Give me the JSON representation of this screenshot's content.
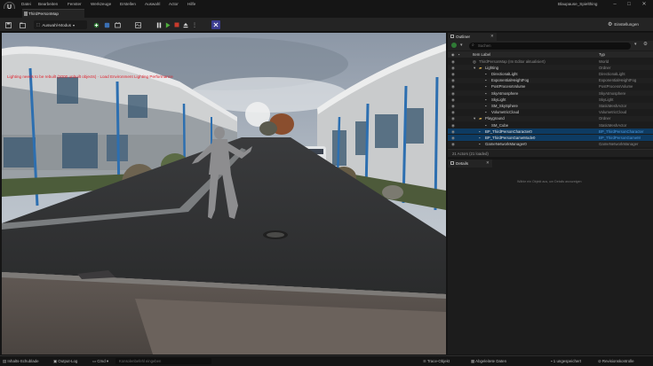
{
  "menu": [
    "Datei",
    "Bearbeiten",
    "Fenster",
    "Werkzeuge",
    "Erstellen",
    "Auswahl",
    "Actor",
    "Hilfe"
  ],
  "project_name": "Blaupause_Spielthing",
  "map_tab": "ThirdPersonMap",
  "toolbar": {
    "mode_label": "Auswahl-Modus",
    "settings_label": "Einstellungen"
  },
  "viewport": {
    "overlay_text": "Lighting needs to be rebuilt (2000 unbuilt objects) · Load Environment Lighting Performance"
  },
  "outliner": {
    "tab_label": "Outliner",
    "search_placeholder": "Suchen",
    "col_label": "Item Label",
    "col_type": "Typ",
    "rows": [
      {
        "label": "ThirdPersonMap (Im Editor aktualisiert)",
        "type": "World",
        "indent": 0,
        "folder": false,
        "active": false,
        "selected": false
      },
      {
        "label": "Lighting",
        "type": "Ordner",
        "indent": 1,
        "folder": true,
        "active": false,
        "selected": false
      },
      {
        "label": "DirectionalLight",
        "type": "DirectionalLight",
        "indent": 2,
        "folder": false,
        "active": true,
        "selected": false
      },
      {
        "label": "ExponentialHeightFog",
        "type": "ExponentialHeightFog",
        "indent": 2,
        "folder": false,
        "active": true,
        "selected": false
      },
      {
        "label": "PostProcessVolume",
        "type": "PostProcessVolume",
        "indent": 2,
        "folder": false,
        "active": true,
        "selected": false
      },
      {
        "label": "SkyAtmosphere",
        "type": "SkyAtmosphere",
        "indent": 2,
        "folder": false,
        "active": true,
        "selected": false
      },
      {
        "label": "SkyLight",
        "type": "SkyLight",
        "indent": 2,
        "folder": false,
        "active": true,
        "selected": false
      },
      {
        "label": "SM_SkySphere",
        "type": "StaticMeshActor",
        "indent": 2,
        "folder": false,
        "active": true,
        "selected": false
      },
      {
        "label": "VolumetricCloud",
        "type": "VolumetricCloud",
        "indent": 2,
        "folder": false,
        "active": true,
        "selected": false
      },
      {
        "label": "Playground",
        "type": "Ordner",
        "indent": 1,
        "folder": true,
        "active": false,
        "selected": false
      },
      {
        "label": "SM_Cube",
        "type": "StaticMeshActor",
        "indent": 2,
        "folder": false,
        "active": true,
        "selected": false
      },
      {
        "label": "BP_ThirdPersonCharacter0",
        "type": "BP_ThirdPersonCharacter",
        "indent": 1,
        "folder": false,
        "active": true,
        "selected": true
      },
      {
        "label": "BP_ThirdPersonGameMode0",
        "type": "BP_ThirdPersonGameM",
        "indent": 1,
        "folder": false,
        "active": true,
        "selected": true
      },
      {
        "label": "GameNetworkManager0",
        "type": "GameNetworkManager",
        "indent": 1,
        "folder": false,
        "active": true,
        "selected": false
      }
    ],
    "footer": "21 Actors (21 loaded)"
  },
  "details": {
    "tab_label": "Details",
    "empty_text": "Wähle ein Objekt aus, um Details anzuzeigen"
  },
  "statusbar": {
    "content_drawer": "Inhalts-Schublade",
    "output_log": "Output-Log",
    "cmd": "Cmd",
    "console_placeholder": "Konsolenbefehl eingeben",
    "trace": "Trace-Objekt",
    "derived_data": "Abgeleitete Daten",
    "unsaved": "1 ungespeichert",
    "revision": "Revisionskontrolle"
  },
  "colors": {
    "accent": "#2f6fa8",
    "selection": "#0e3b62",
    "active_red": "#c93a2c",
    "play_green": "#4fae3c"
  }
}
